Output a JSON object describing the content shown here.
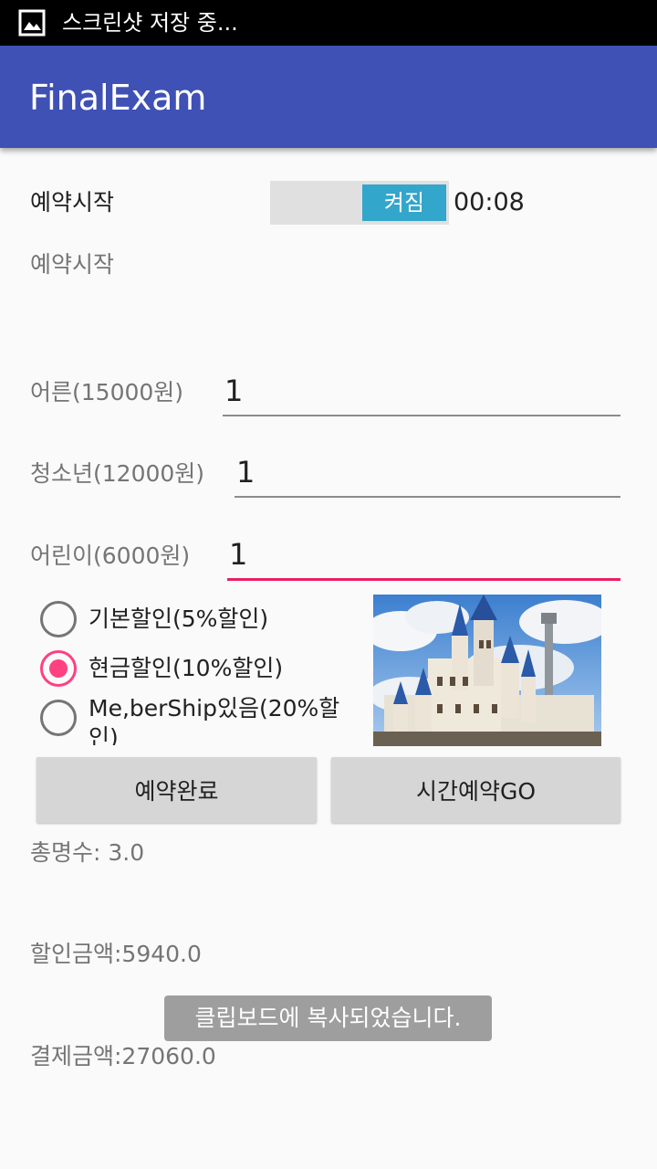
{
  "status_bar": {
    "notification_text": "스크린샷 저장 중..."
  },
  "app_bar": {
    "title": "FinalExam"
  },
  "reservation": {
    "switch_label": "예약시작",
    "switch_state": "켜짐",
    "timer": "00:08",
    "status_text": "예약시작"
  },
  "tickets": {
    "adult_label": "어른(15000원)",
    "adult_value": "1",
    "teen_label": "청소년(12000원)",
    "teen_value": "1",
    "child_label": "어린이(6000원)",
    "child_value": "1"
  },
  "discounts": {
    "options": [
      "기본할인(5%할인)",
      "현금할인(10%할인)",
      "Me,berShip있음(20%할인)"
    ],
    "selected": "현금할인(10%할인)"
  },
  "image": {
    "name": "castle-photo"
  },
  "buttons": {
    "confirm": "예약완료",
    "timed": "시간예약GO"
  },
  "results": {
    "total_count": "총명수: 3.0",
    "discount_amount": "할인금액:5940.0",
    "payment_amount": "결제금액:27060.0"
  },
  "toast": {
    "message": "클립보드에 복사되었습니다."
  },
  "colors": {
    "primary": "#3f51b5",
    "accent": "#ff4081",
    "switch_on": "#33a6cc"
  }
}
